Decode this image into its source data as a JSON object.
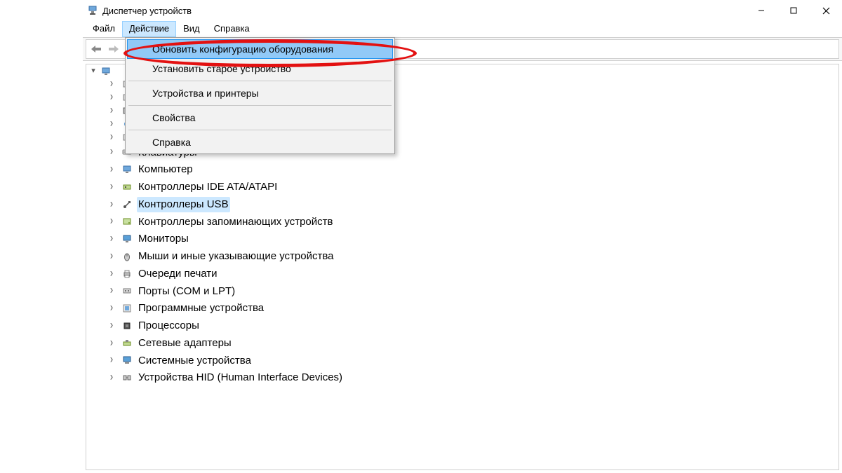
{
  "window": {
    "title": "Диспетчер устройств",
    "controls": {
      "minimize": "–",
      "maximize": "☐",
      "close": "✕"
    }
  },
  "menubar": {
    "items": [
      {
        "label": "Файл"
      },
      {
        "label": "Действие",
        "active": true
      },
      {
        "label": "Вид"
      },
      {
        "label": "Справка"
      }
    ]
  },
  "dropdown": {
    "items": [
      {
        "label": "Обновить конфигурацию оборудования",
        "highlight": true
      },
      {
        "label": "Установить старое устройство"
      },
      {
        "sep": true
      },
      {
        "label": "Устройства и принтеры"
      },
      {
        "sep": true
      },
      {
        "label": "Свойства"
      },
      {
        "sep": true
      },
      {
        "label": "Справка"
      }
    ]
  },
  "tree": {
    "root_label": "",
    "nodes": [
      {
        "label": "",
        "icon": "device-icon"
      },
      {
        "label": "",
        "icon": "device-icon"
      },
      {
        "label": "",
        "icon": "disk-icon"
      },
      {
        "label": "",
        "icon": "audio-icon"
      },
      {
        "label": "",
        "icon": "device-icon"
      },
      {
        "label": "Клавиатуры",
        "icon": "keyboard-icon"
      },
      {
        "label": "Компьютер",
        "icon": "computer-icon"
      },
      {
        "label": "Контроллеры IDE ATA/ATAPI",
        "icon": "ide-icon"
      },
      {
        "label": "Контроллеры USB",
        "icon": "usb-icon",
        "selected": true
      },
      {
        "label": "Контроллеры запоминающих устройств",
        "icon": "storage-icon"
      },
      {
        "label": "Мониторы",
        "icon": "monitor-icon"
      },
      {
        "label": "Мыши и иные указывающие устройства",
        "icon": "mouse-icon"
      },
      {
        "label": "Очереди печати",
        "icon": "printer-icon"
      },
      {
        "label": "Порты (COM и LPT)",
        "icon": "port-icon"
      },
      {
        "label": "Программные устройства",
        "icon": "software-icon"
      },
      {
        "label": "Процессоры",
        "icon": "cpu-icon"
      },
      {
        "label": "Сетевые адаптеры",
        "icon": "network-icon"
      },
      {
        "label": "Системные устройства",
        "icon": "system-icon"
      },
      {
        "label": "Устройства HID (Human Interface Devices)",
        "icon": "hid-icon"
      }
    ]
  },
  "toolbar": {
    "back": "back-icon",
    "forward": "forward-icon",
    "up": "up-icon"
  }
}
